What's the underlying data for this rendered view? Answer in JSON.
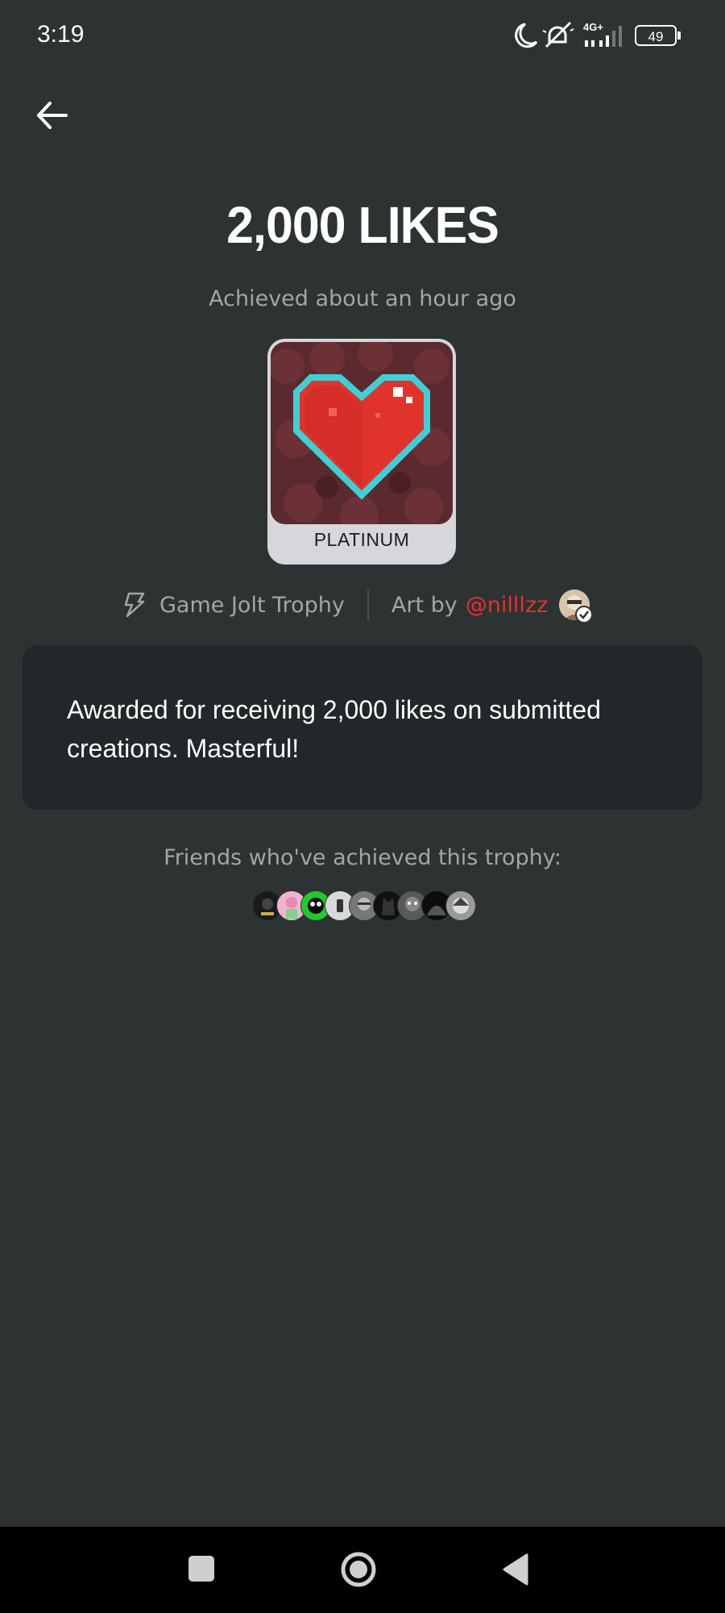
{
  "status_bar": {
    "time": "3:19",
    "network": "4G+",
    "battery": "49",
    "icons": [
      "moon-icon",
      "muted-bell-icon",
      "signal-icon",
      "battery-icon"
    ]
  },
  "header": {
    "back_icon": "arrow-left-icon"
  },
  "trophy": {
    "title": "2,000 LIKES",
    "achieved": "Achieved about an hour ago",
    "tier": "PLATINUM",
    "image_icon": "pixel-heart-icon",
    "source_label": "Game Jolt Trophy",
    "source_icon": "bolt-icon",
    "art_by_prefix": "Art by",
    "artist": "@nilllzz",
    "description": "Awarded for receiving 2,000 likes on submitted creations. Masterful!"
  },
  "friends": {
    "label": "Friends who've achieved this trophy:",
    "avatar_count": 9
  },
  "nav": {
    "icons": [
      "recents-square-icon",
      "home-circle-icon",
      "back-triangle-icon"
    ]
  },
  "colors": {
    "background": "#2c3332",
    "card": "#22282a",
    "link": "#e53030",
    "muted_text": "#a2a7a6",
    "tier_plate": "#d6d7dc"
  }
}
